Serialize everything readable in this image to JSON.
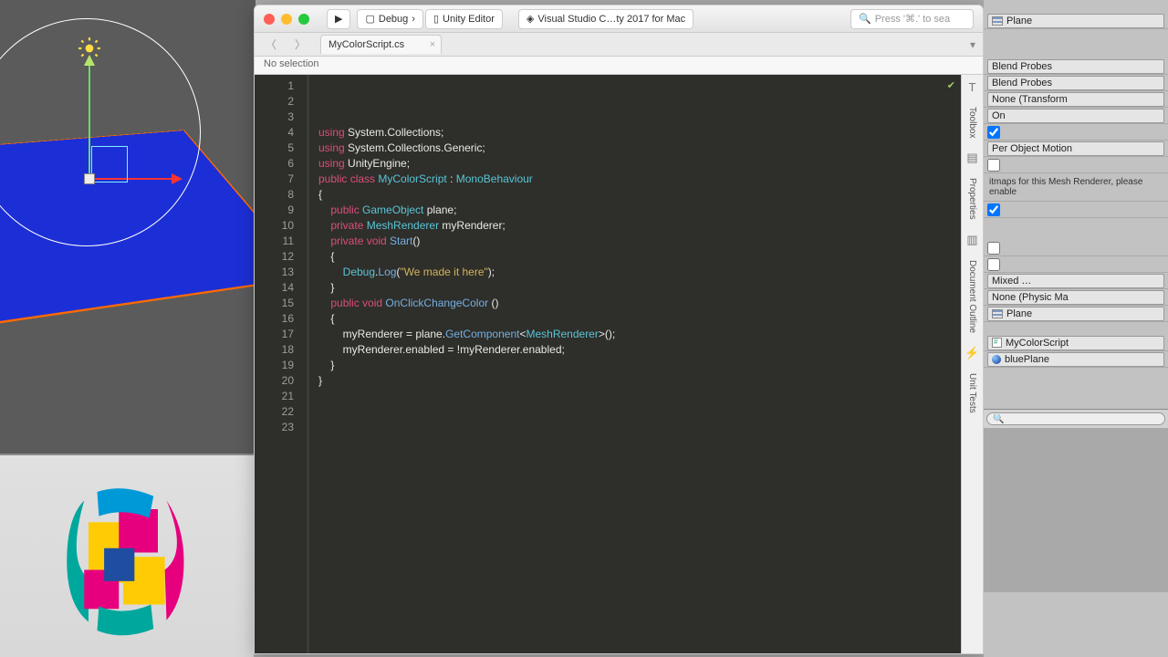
{
  "toolbar": {
    "run_icon": "▶",
    "config": "Debug",
    "sep": "›",
    "target": "Unity Editor",
    "ide": "Visual Studio C…ty 2017 for Mac",
    "search_placeholder": "Press '⌘.' to sea"
  },
  "tab": {
    "filename": "MyColorScript.cs"
  },
  "crumb": "No selection",
  "side": {
    "toolbox": "Toolbox",
    "properties": "Properties",
    "outline": "Document Outline",
    "tests": "Unit Tests"
  },
  "code": {
    "lines": [
      {
        "n": 1,
        "seg": [
          [
            "kw",
            "using"
          ],
          [
            "",
            ""
          ],
          [
            "id",
            " System.Collections;"
          ]
        ]
      },
      {
        "n": 2,
        "seg": [
          [
            "kw",
            "using"
          ],
          [
            "id",
            " System.Collections.Generic;"
          ]
        ]
      },
      {
        "n": 3,
        "seg": [
          [
            "kw",
            "using"
          ],
          [
            "id",
            " UnityEngine;"
          ]
        ]
      },
      {
        "n": 4,
        "seg": [
          [
            "",
            ""
          ]
        ]
      },
      {
        "n": 5,
        "seg": [
          [
            "kw",
            "public class "
          ],
          [
            "type",
            "MyColorScript"
          ],
          [
            "id",
            " : "
          ],
          [
            "type",
            "MonoBehaviour"
          ]
        ]
      },
      {
        "n": 6,
        "seg": [
          [
            "id",
            "{"
          ]
        ]
      },
      {
        "n": 7,
        "seg": [
          [
            "",
            ""
          ]
        ]
      },
      {
        "n": 8,
        "seg": [
          [
            "id",
            "    "
          ],
          [
            "kw",
            "public "
          ],
          [
            "type",
            "GameObject"
          ],
          [
            "id",
            " plane;"
          ]
        ]
      },
      {
        "n": 9,
        "seg": [
          [
            "id",
            "    "
          ],
          [
            "kw",
            "private "
          ],
          [
            "type",
            "MeshRenderer"
          ],
          [
            "id",
            " myRenderer;"
          ]
        ]
      },
      {
        "n": 10,
        "seg": [
          [
            "",
            ""
          ]
        ]
      },
      {
        "n": 11,
        "seg": [
          [
            "id",
            "    "
          ],
          [
            "kw",
            "private void "
          ],
          [
            "fn",
            "Start"
          ],
          [
            "id",
            "()"
          ]
        ]
      },
      {
        "n": 12,
        "seg": [
          [
            "id",
            "    {"
          ]
        ]
      },
      {
        "n": 13,
        "seg": [
          [
            "id",
            "        "
          ],
          [
            "type",
            "Debug"
          ],
          [
            "id",
            "."
          ],
          [
            "fn",
            "Log"
          ],
          [
            "id",
            "("
          ],
          [
            "str",
            "\"We made it here\""
          ],
          [
            "id",
            ");"
          ]
        ]
      },
      {
        "n": 14,
        "seg": [
          [
            "id",
            "    }"
          ]
        ]
      },
      {
        "n": 15,
        "seg": [
          [
            "",
            ""
          ]
        ]
      },
      {
        "n": 16,
        "seg": [
          [
            "id",
            "    "
          ],
          [
            "kw",
            "public void "
          ],
          [
            "fn",
            "OnClickChangeColor"
          ],
          [
            "id",
            " ()"
          ]
        ]
      },
      {
        "n": 17,
        "seg": [
          [
            "id",
            "    {"
          ]
        ]
      },
      {
        "n": 18,
        "seg": [
          [
            "id",
            "        myRenderer = plane."
          ],
          [
            "fn",
            "GetComponent"
          ],
          [
            "id",
            "<"
          ],
          [
            "type",
            "MeshRenderer"
          ],
          [
            "id",
            ">();"
          ]
        ]
      },
      {
        "n": 19,
        "seg": [
          [
            "id",
            "        myRenderer.enabled = !myRenderer.enabled;"
          ]
        ]
      },
      {
        "n": 20,
        "seg": [
          [
            "id",
            "    }"
          ]
        ]
      },
      {
        "n": 21,
        "seg": [
          [
            "",
            ""
          ]
        ]
      },
      {
        "n": 22,
        "seg": [
          [
            "id",
            "}"
          ]
        ]
      },
      {
        "n": 23,
        "seg": [
          [
            "",
            ""
          ]
        ]
      }
    ]
  },
  "inspector": {
    "plane": "Plane",
    "blendProbes": "Blend Probes",
    "noneTransform": "None (Transform",
    "on": "On",
    "perObject": "Per Object Motion",
    "note": "itmaps for this Mesh Renderer, please enable",
    "mixed": "Mixed …",
    "nonePhysic": "None (Physic Ma",
    "scriptName": "MyColorScript",
    "bluePlane": "bluePlane"
  }
}
